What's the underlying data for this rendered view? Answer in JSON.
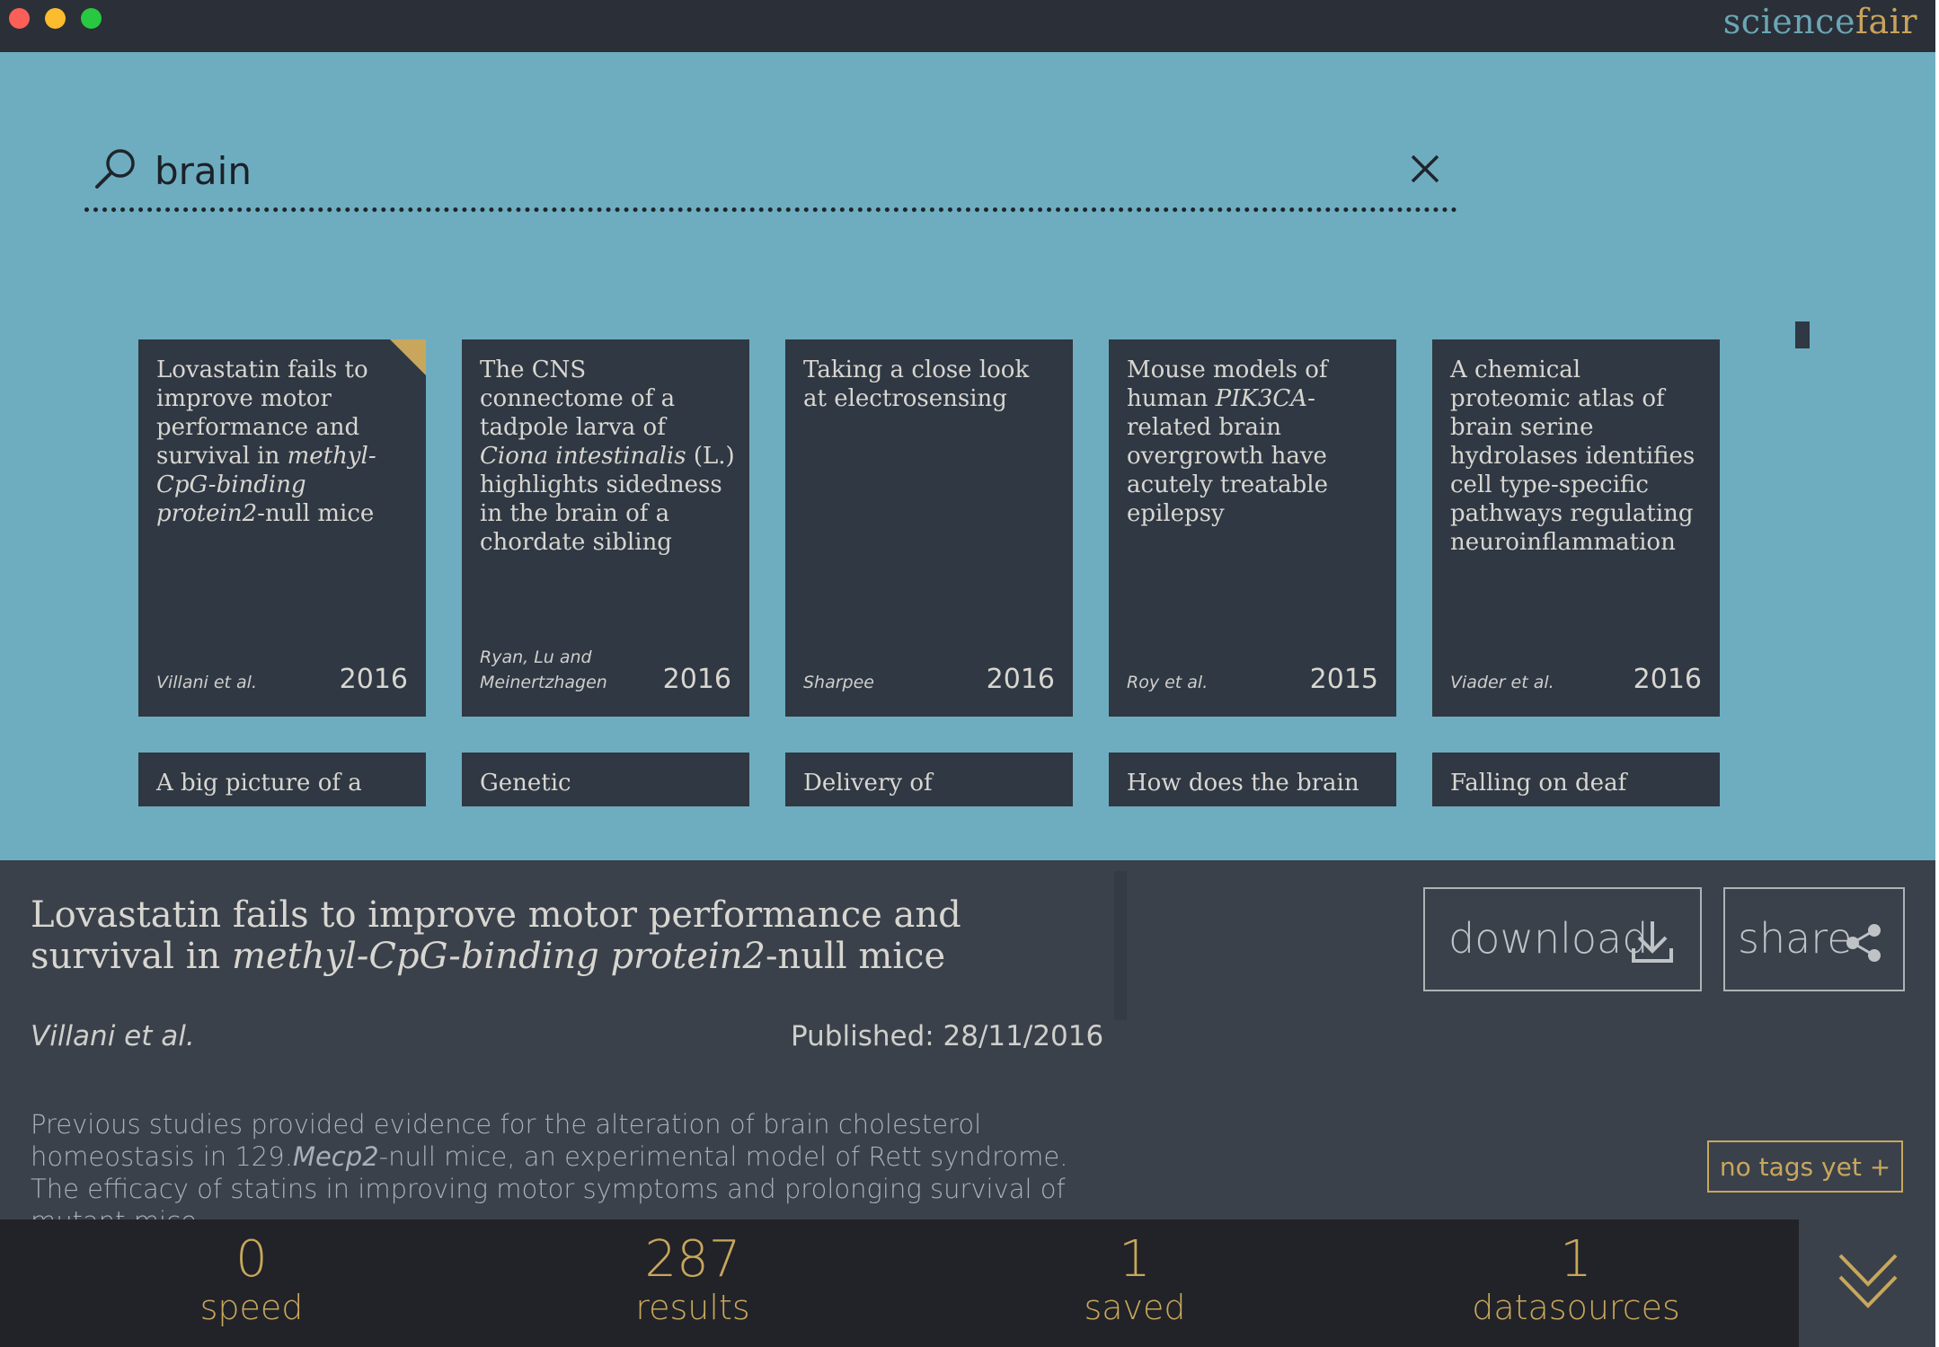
{
  "app": {
    "brand_part1": "science",
    "brand_part2": "fair"
  },
  "search": {
    "query": "brain",
    "icon": "search-icon",
    "clear_icon": "close-icon"
  },
  "results": {
    "row1": [
      {
        "title_html": "Lovastatin fails to improve motor performance and survival in <i>methyl-CpG-binding protein2</i>-null mice",
        "authors": "Villani et al.",
        "year": "2016",
        "selected": true
      },
      {
        "title_html": "The CNS connectome of a tadpole larva of <i>Ciona intestinalis</i> (L.) highlights sidedness in the brain of a chordate sibling",
        "authors": "Ryan, Lu and Meinertzhagen",
        "year": "2016",
        "selected": false
      },
      {
        "title_html": "Taking a close look at electrosensing",
        "authors": "Sharpee",
        "year": "2016",
        "selected": false
      },
      {
        "title_html": "Mouse models of human <i>PIK3CA</i>-related brain overgrowth have acutely treatable epilepsy",
        "authors": "Roy et al.",
        "year": "2015",
        "selected": false
      },
      {
        "title_html": "A chemical proteomic atlas of brain serine hydrolases identifies cell type-specific pathways regulating neuroinflammation",
        "authors": "Viader et al.",
        "year": "2016",
        "selected": false
      }
    ],
    "row2": [
      {
        "title": "A big picture of a"
      },
      {
        "title": "Genetic"
      },
      {
        "title": "Delivery of"
      },
      {
        "title": "How does the brain"
      },
      {
        "title": "Falling on deaf"
      }
    ]
  },
  "detail": {
    "title_html": "Lovastatin fails to improve motor performance and survival in <i>methyl-CpG-binding protein2</i>-null mice",
    "authors": "Villani et al.",
    "published": "Published: 28/11/2016",
    "abstract_html": "Previous studies provided evidence for the alteration of brain cholesterol homeostasis in 129.<i>Mecp2</i>-null mice, an experimental model of Rett syndrome. The efficacy of statins in improving motor symptoms and prolonging survival of mutant mice",
    "download_label": "download",
    "share_label": "share",
    "tags_label": "no tags yet +"
  },
  "stats": [
    {
      "value": "0",
      "label": "speed"
    },
    {
      "value": "287",
      "label": "results"
    },
    {
      "value": "1",
      "label": "saved"
    },
    {
      "value": "1",
      "label": "datasources"
    }
  ],
  "colors": {
    "accent": "#c8a75c",
    "search_bg": "#6eadbf",
    "card_bg": "#2f3843",
    "panel_bg": "#3a414b",
    "footer_bg": "#222328"
  }
}
